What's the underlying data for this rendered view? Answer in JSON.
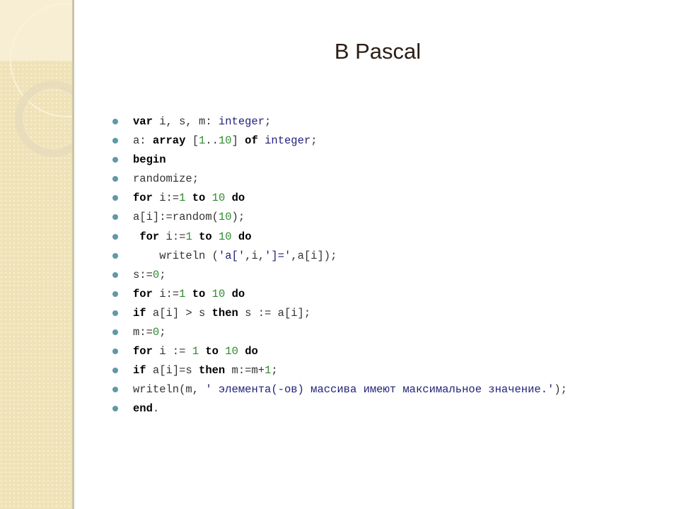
{
  "slide": {
    "title": "В Pascal",
    "colors": {
      "keyword": "#000000",
      "number": "#2e8b2e",
      "type": "#22237a",
      "string": "#22237a",
      "plain": "#333333",
      "bullet": "#5f9aa3",
      "sidebar": "#efe2b8"
    },
    "code_lines": [
      [
        {
          "t": "kw",
          "v": "var"
        },
        {
          "t": "plain",
          "v": " i, s, m: "
        },
        {
          "t": "typ",
          "v": "integer"
        },
        {
          "t": "plain",
          "v": ";"
        }
      ],
      [
        {
          "t": "plain",
          "v": "a: "
        },
        {
          "t": "kw",
          "v": "array"
        },
        {
          "t": "plain",
          "v": " ["
        },
        {
          "t": "num",
          "v": "1"
        },
        {
          "t": "plain",
          "v": ".."
        },
        {
          "t": "num",
          "v": "10"
        },
        {
          "t": "plain",
          "v": "] "
        },
        {
          "t": "kw",
          "v": "of"
        },
        {
          "t": "plain",
          "v": " "
        },
        {
          "t": "typ",
          "v": "integer"
        },
        {
          "t": "plain",
          "v": ";"
        }
      ],
      [
        {
          "t": "kw",
          "v": "begin"
        }
      ],
      [
        {
          "t": "plain",
          "v": "randomize;"
        }
      ],
      [
        {
          "t": "kw",
          "v": "for"
        },
        {
          "t": "plain",
          "v": " i:="
        },
        {
          "t": "num",
          "v": "1"
        },
        {
          "t": "plain",
          "v": " "
        },
        {
          "t": "kw",
          "v": "to"
        },
        {
          "t": "plain",
          "v": " "
        },
        {
          "t": "num",
          "v": "10"
        },
        {
          "t": "plain",
          "v": " "
        },
        {
          "t": "kw",
          "v": "do"
        }
      ],
      [
        {
          "t": "plain",
          "v": "a[i]:=random("
        },
        {
          "t": "num",
          "v": "10"
        },
        {
          "t": "plain",
          "v": ");"
        }
      ],
      [
        {
          "t": "plain",
          "v": " "
        },
        {
          "t": "kw",
          "v": "for"
        },
        {
          "t": "plain",
          "v": " i:="
        },
        {
          "t": "num",
          "v": "1"
        },
        {
          "t": "plain",
          "v": " "
        },
        {
          "t": "kw",
          "v": "to"
        },
        {
          "t": "plain",
          "v": " "
        },
        {
          "t": "num",
          "v": "10"
        },
        {
          "t": "plain",
          "v": " "
        },
        {
          "t": "kw",
          "v": "do"
        }
      ],
      [
        {
          "t": "plain",
          "v": "    writeln ("
        },
        {
          "t": "str",
          "v": "'a['"
        },
        {
          "t": "plain",
          "v": ",i,"
        },
        {
          "t": "str",
          "v": "']='"
        },
        {
          "t": "plain",
          "v": ",a[i]);"
        }
      ],
      [
        {
          "t": "plain",
          "v": "s:="
        },
        {
          "t": "num",
          "v": "0"
        },
        {
          "t": "plain",
          "v": ";"
        }
      ],
      [
        {
          "t": "kw",
          "v": "for"
        },
        {
          "t": "plain",
          "v": " i:="
        },
        {
          "t": "num",
          "v": "1"
        },
        {
          "t": "plain",
          "v": " "
        },
        {
          "t": "kw",
          "v": "to"
        },
        {
          "t": "plain",
          "v": " "
        },
        {
          "t": "num",
          "v": "10"
        },
        {
          "t": "plain",
          "v": " "
        },
        {
          "t": "kw",
          "v": "do"
        }
      ],
      [
        {
          "t": "kw",
          "v": "if"
        },
        {
          "t": "plain",
          "v": " a[i] > s "
        },
        {
          "t": "kw",
          "v": "then"
        },
        {
          "t": "plain",
          "v": " s := a[i];"
        }
      ],
      [
        {
          "t": "plain",
          "v": "m:="
        },
        {
          "t": "num",
          "v": "0"
        },
        {
          "t": "plain",
          "v": ";"
        }
      ],
      [
        {
          "t": "kw",
          "v": "for"
        },
        {
          "t": "plain",
          "v": " i := "
        },
        {
          "t": "num",
          "v": "1"
        },
        {
          "t": "plain",
          "v": " "
        },
        {
          "t": "kw",
          "v": "to"
        },
        {
          "t": "plain",
          "v": " "
        },
        {
          "t": "num",
          "v": "10"
        },
        {
          "t": "plain",
          "v": " "
        },
        {
          "t": "kw",
          "v": "do"
        }
      ],
      [
        {
          "t": "kw",
          "v": "if"
        },
        {
          "t": "plain",
          "v": " a[i]=s "
        },
        {
          "t": "kw",
          "v": "then"
        },
        {
          "t": "plain",
          "v": " m:=m+"
        },
        {
          "t": "num",
          "v": "1"
        },
        {
          "t": "plain",
          "v": ";"
        }
      ],
      [
        {
          "t": "plain",
          "v": "writeln(m, "
        },
        {
          "t": "str",
          "v": "' элемента(-ов) массива имеют максимальное значение.'"
        },
        {
          "t": "plain",
          "v": ");"
        }
      ],
      [
        {
          "t": "kw",
          "v": "end"
        },
        {
          "t": "plain",
          "v": "."
        }
      ]
    ]
  }
}
